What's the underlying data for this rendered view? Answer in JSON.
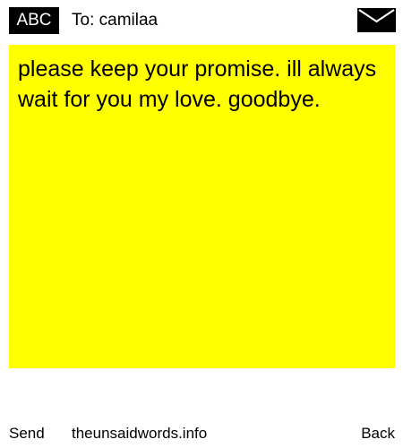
{
  "header": {
    "badge_label": "ABC",
    "recipient": "To: camilaa",
    "mail_icon": "envelope-icon"
  },
  "message": {
    "text": "please keep your promise. ill always wait for you my love. goodbye."
  },
  "footer": {
    "send_label": "Send",
    "site_label": "theunsaidwords.info",
    "back_label": "Back"
  },
  "colors": {
    "message_background": "#ffff00",
    "badge_background": "#000000",
    "badge_text": "#ffffff",
    "text": "#000000"
  }
}
